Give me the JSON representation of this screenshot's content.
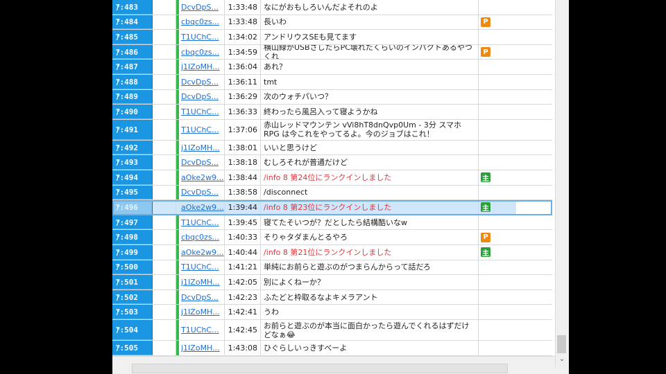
{
  "rows": [
    {
      "no": "ｱ:483",
      "user": "DcvDpS...",
      "time": "1:33:48",
      "msg": "なにがおもしろいんだよそれのよ",
      "badge": "",
      "info": false
    },
    {
      "no": "ｱ:484",
      "user": "cbqc0zs...",
      "time": "1:33:48",
      "msg": "長いわ",
      "badge": "P",
      "info": false
    },
    {
      "no": "ｱ:485",
      "user": "T1UChC...",
      "time": "1:34:02",
      "msg": "アンドリウスSEも見てます",
      "badge": "",
      "info": false
    },
    {
      "no": "ｱ:486",
      "user": "cbqc0zs...",
      "time": "1:34:59",
      "msg": "横山緑がUSBさしたらPC壊れたくらいのインパクトあるやつくれ",
      "badge": "P",
      "info": false
    },
    {
      "no": "ｱ:487",
      "user": "j1IZoMH...",
      "time": "1:36:04",
      "msg": "あれ？",
      "badge": "",
      "info": false
    },
    {
      "no": "ｱ:488",
      "user": "DcvDpS...",
      "time": "1:36:11",
      "msg": "tmt",
      "badge": "",
      "info": false
    },
    {
      "no": "ｱ:489",
      "user": "DcvDpS...",
      "time": "1:36:29",
      "msg": "次のウォチパいつ？",
      "badge": "",
      "info": false
    },
    {
      "no": "ｱ:490",
      "user": "T1UChC...",
      "time": "1:36:33",
      "msg": "終わったら風呂入って寝ようかね",
      "badge": "",
      "info": false
    },
    {
      "no": "ｱ:491",
      "user": "T1UChC...",
      "time": "1:37:06",
      "msg": "赤山レッドマウンテン vVi8hT8dnQvp0Um - 3分 スマホRPG は今これをやってるよ。今のジョブはこれ！",
      "badge": "",
      "info": false,
      "tall": true
    },
    {
      "no": "ｱ:492",
      "user": "j1IZoMH...",
      "time": "1:38:01",
      "msg": "いいと思うけど",
      "badge": "",
      "info": false
    },
    {
      "no": "ｱ:493",
      "user": "DcvDpS...",
      "time": "1:38:18",
      "msg": "むしろそれが普通だけど",
      "badge": "",
      "info": false
    },
    {
      "no": "ｱ:494",
      "user": "aOke2w9...",
      "time": "1:38:44",
      "msg": "/info 8 第24位にランクインしました",
      "badge": "主",
      "info": true
    },
    {
      "no": "ｱ:495",
      "user": "DcvDpS...",
      "time": "1:38:58",
      "msg": "/disconnect",
      "badge": "",
      "info": false
    },
    {
      "no": "ｱ:496",
      "user": "aOke2w9...",
      "time": "1:39:44",
      "msg": "/info 8 第23位にランクインしました",
      "badge": "主",
      "info": true,
      "selected": true
    },
    {
      "no": "ｱ:497",
      "user": "T1UChC...",
      "time": "1:39:45",
      "msg": "寝てたそいつが？だとしたら結構酷いなw",
      "badge": "",
      "info": false
    },
    {
      "no": "ｱ:498",
      "user": "cbqc0zs...",
      "time": "1:40:33",
      "msg": "そりゃタダまんとるやろ",
      "badge": "P",
      "info": false
    },
    {
      "no": "ｱ:499",
      "user": "aOke2w9...",
      "time": "1:40:44",
      "msg": "/info 8 第21位にランクインしました",
      "badge": "主",
      "info": true
    },
    {
      "no": "ｱ:500",
      "user": "T1UChC...",
      "time": "1:41:21",
      "msg": "単純にお前らと遊ぶのがつまらんからって話だろ",
      "badge": "",
      "info": false
    },
    {
      "no": "ｱ:501",
      "user": "j1IZoMH...",
      "time": "1:42:05",
      "msg": "別によくねーか？",
      "badge": "",
      "info": false
    },
    {
      "no": "ｱ:502",
      "user": "DcvDpS...",
      "time": "1:42:23",
      "msg": "ふたどと枠取るなよキメラアント",
      "badge": "",
      "info": false
    },
    {
      "no": "ｱ:503",
      "user": "j1IZoMH...",
      "time": "1:42:41",
      "msg": "うわ",
      "badge": "",
      "info": false
    },
    {
      "no": "ｱ:504",
      "user": "T1UChC...",
      "time": "1:42:45",
      "msg": "お前らと遊ぶのが本当に面白かったら遊んでくれるはずだけどなぁ😂",
      "badge": "",
      "info": false,
      "tall": true
    },
    {
      "no": "ｱ:505",
      "user": "j1IZoMH...",
      "time": "1:43:08",
      "msg": "ひぐらしいっきすべーよ",
      "badge": "",
      "info": false
    }
  ],
  "scroll": {
    "down_arrow": "⌄"
  },
  "colors": {
    "number_col": "#1b96e2",
    "user_link": "#1f6fd1",
    "info_text": "#e0353b",
    "badge_p": "#ee8a13",
    "badge_owner": "#2c9f3a"
  }
}
